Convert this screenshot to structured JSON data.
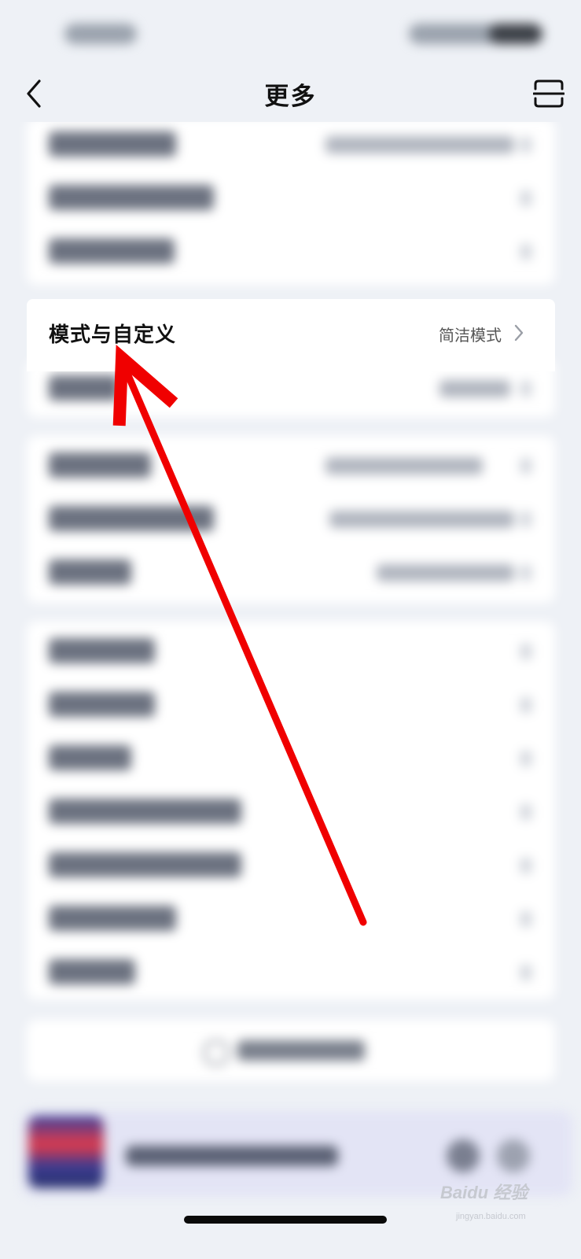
{
  "nav": {
    "title": "更多",
    "back_icon": "chevron-left-icon",
    "scan_icon": "scan-icon"
  },
  "focused_setting": {
    "label": "模式与自定义",
    "value": "简洁模式"
  },
  "watermark": {
    "text": "Baidu 经验",
    "sub": "jingyan.baidu.com"
  },
  "colors": {
    "background": "#eef1f6",
    "card": "#ffffff",
    "annotation_arrow": "#f00000"
  }
}
